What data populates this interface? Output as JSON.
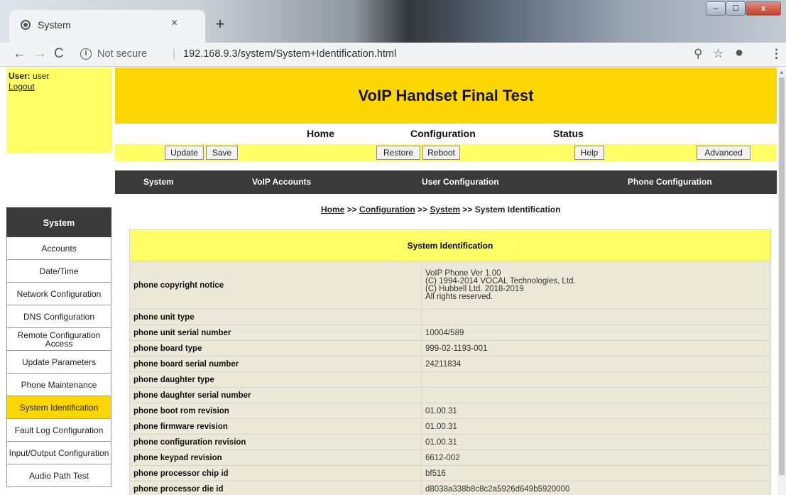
{
  "browser": {
    "tab_title": "System",
    "tab_close": "×",
    "new_tab": "+",
    "window_controls": {
      "minimize": "–",
      "maximize": "☐",
      "close": "x"
    },
    "nav": {
      "back": "←",
      "forward": "→",
      "reload": "C"
    },
    "security_label": "Not secure",
    "separator": "|",
    "url": "192.168.9.3/system/System+Identification.html"
  },
  "user": {
    "label": "User:",
    "name": "user",
    "logout": "Logout"
  },
  "banner_title": "VoIP Handset Final Test",
  "top_nav": {
    "home": "Home",
    "configuration": "Configuration",
    "status": "Status"
  },
  "buttons": {
    "update": "Update",
    "save": "Save",
    "restore": "Restore",
    "reboot": "Reboot",
    "help": "Help",
    "advanced": "Advanced"
  },
  "section_nav": {
    "system": "System",
    "voip_accounts": "VoIP Accounts",
    "user_configuration": "User Configuration",
    "phone_configuration": "Phone Configuration"
  },
  "breadcrumb": {
    "home": "Home",
    "sep1": " >> ",
    "configuration": "Configuration",
    "sep2": " >> ",
    "system": "System",
    "sep3": " >> ",
    "current": "System Identification"
  },
  "sidebar": {
    "heading": "System",
    "items": [
      {
        "label": "Accounts"
      },
      {
        "label": "Date/Time"
      },
      {
        "label": "Network Configuration"
      },
      {
        "label": "DNS Configuration"
      },
      {
        "label": "Remote Configuration Access"
      },
      {
        "label": "Update Parameters"
      },
      {
        "label": "Phone Maintenance"
      },
      {
        "label": "System Identification",
        "active": true
      },
      {
        "label": "Fault Log Configuration"
      },
      {
        "label": "Input/Output Configuration"
      },
      {
        "label": "Audio Path Test"
      }
    ]
  },
  "table": {
    "title": "System Identification",
    "copyright": {
      "key": "phone copyright notice",
      "lines": [
        "VoIP Phone Ver 1.00",
        "(C) 1994-2014 VOCAL Technologies, Ltd.",
        "(C) Hubbell Ltd. 2018-2019",
        "All rights reserved."
      ]
    },
    "rows": [
      {
        "key": "phone unit type",
        "value": ""
      },
      {
        "key": "phone unit serial number",
        "value": "10004/589"
      },
      {
        "key": "phone board type",
        "value": "999-02-1193-001"
      },
      {
        "key": "phone board serial number",
        "value": "24211834"
      },
      {
        "key": "phone daughter type",
        "value": ""
      },
      {
        "key": "phone daughter serial number",
        "value": ""
      },
      {
        "key": "phone boot rom revision",
        "value": "01.00.31"
      },
      {
        "key": "phone firmware revision",
        "value": "01.00.31"
      },
      {
        "key": "phone configuration revision",
        "value": "01.00.31"
      },
      {
        "key": "phone keypad revision",
        "value": "6612-002"
      },
      {
        "key": "phone processor chip id",
        "value": "bf516"
      },
      {
        "key": "phone processor die id",
        "value": "d8038a338b8c8c2a5926d649b5920000"
      }
    ]
  }
}
